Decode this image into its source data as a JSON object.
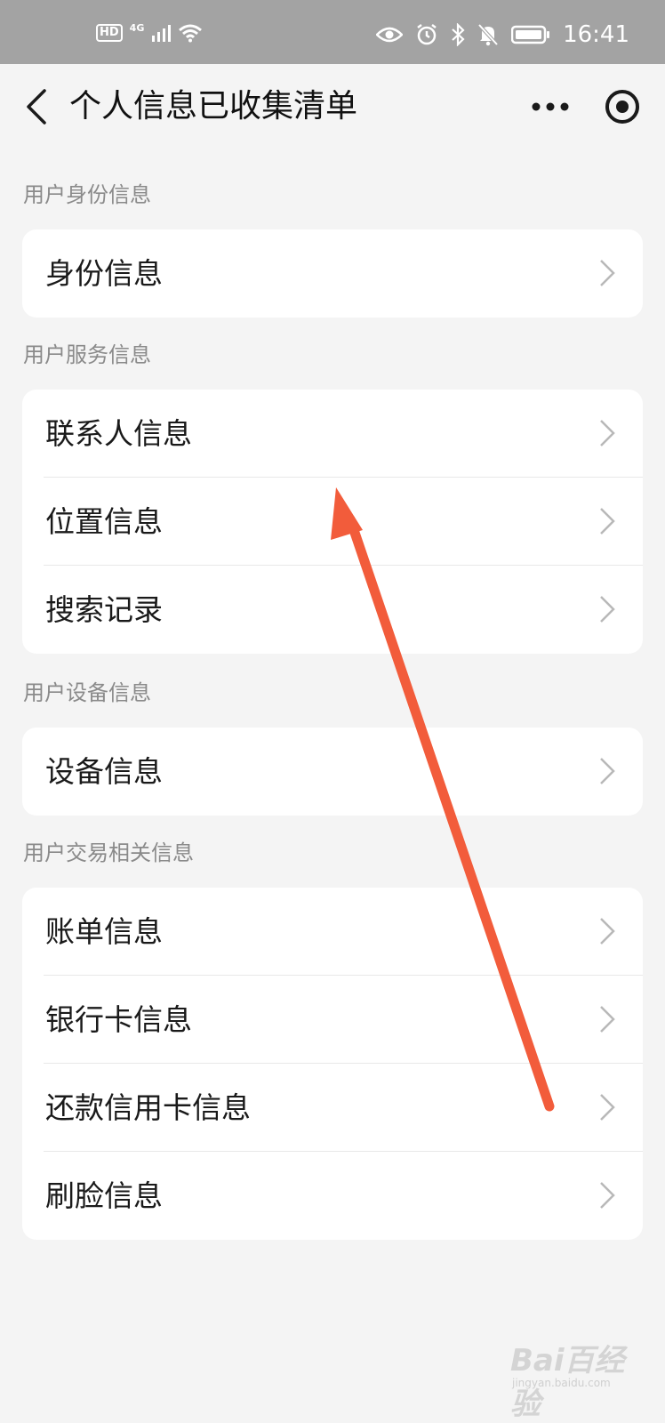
{
  "status_bar": {
    "hd": "HD",
    "network": "4G",
    "time": "16:41",
    "icons": [
      "hd-icon",
      "signal-icon",
      "wifi-icon",
      "eye-icon",
      "alarm-icon",
      "bluetooth-icon",
      "mute-bell-icon",
      "battery-icon"
    ]
  },
  "nav": {
    "title": "个人信息已收集清单",
    "back_icon": "chevron-left-icon",
    "more_icon": "more-dots-icon",
    "close_icon": "target-circle-icon"
  },
  "sections": [
    {
      "label": "用户身份信息",
      "items": [
        {
          "label": "身份信息"
        }
      ]
    },
    {
      "label": "用户服务信息",
      "items": [
        {
          "label": "联系人信息"
        },
        {
          "label": "位置信息"
        },
        {
          "label": "搜索记录"
        }
      ]
    },
    {
      "label": "用户设备信息",
      "items": [
        {
          "label": "设备信息"
        }
      ]
    },
    {
      "label": "用户交易相关信息",
      "items": [
        {
          "label": "账单信息"
        },
        {
          "label": "银行卡信息"
        },
        {
          "label": "还款信用卡信息"
        },
        {
          "label": "刷脸信息"
        }
      ]
    }
  ],
  "annotation": {
    "color": "#f25c3b"
  },
  "watermark": {
    "brand": "Bai百经验",
    "site": "jingyan.baidu.com"
  }
}
